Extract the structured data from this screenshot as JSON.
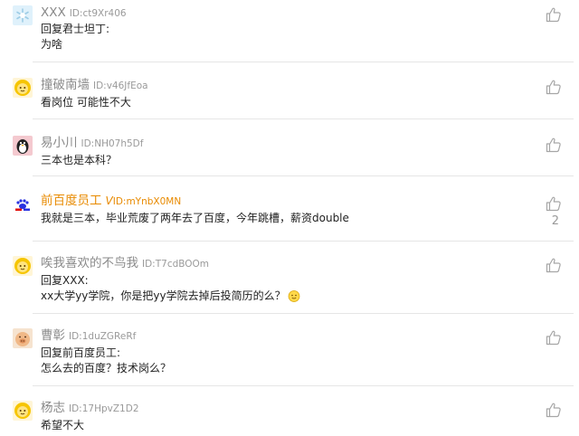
{
  "comments": [
    {
      "name": "XXX",
      "id_text": "ID:ct9Xr406",
      "lines": [
        "回复君士坦丁:",
        "为啥"
      ],
      "avatar": "snowflake-avatar",
      "likes": ""
    },
    {
      "name": "撞破南墙",
      "id_text": "ID:v46JfEoa",
      "lines": [
        "看岗位 可能性不大"
      ],
      "avatar": "yellow-face-avatar",
      "likes": ""
    },
    {
      "name": "易小川",
      "id_text": "ID:NH07h5Df",
      "lines": [
        "三本也是本科？"
      ],
      "avatar": "penguin-avatar",
      "likes": ""
    },
    {
      "name": "前百度员工",
      "badge": "V",
      "id_text": "ID:mYnbX0MN",
      "lines": [
        "我就是三本，毕业荒废了两年去了百度，今年跳槽，薪资double"
      ],
      "avatar": "baidu-logo-avatar",
      "likes": "2"
    },
    {
      "name": "唉我喜欢的不鸟我",
      "id_text": "ID:T7cdBOOm",
      "lines": [
        "回复XXX:",
        "xx大学yy学院，你是把yy学院去掉后投简历的么？"
      ],
      "avatar": "yellow-face-avatar",
      "likes": ""
    },
    {
      "name": "曹彰",
      "id_text": "ID:1duZGReRf",
      "lines": [
        "回复前百度员工:",
        "怎么去的百度？技术岗么？"
      ],
      "avatar": "pig-avatar",
      "likes": ""
    },
    {
      "name": "杨志",
      "id_text": "ID:17HpvZ1D2",
      "lines": [
        "希望不大"
      ],
      "avatar": "yellow-face-avatar",
      "likes": ""
    }
  ],
  "colors": {
    "vip": "#e88a00",
    "meta": "#9a9a9a",
    "divider": "#e6e6e6"
  },
  "icons": {
    "like": "thumbs-up-icon",
    "emoji": "smile-emoji-icon"
  }
}
